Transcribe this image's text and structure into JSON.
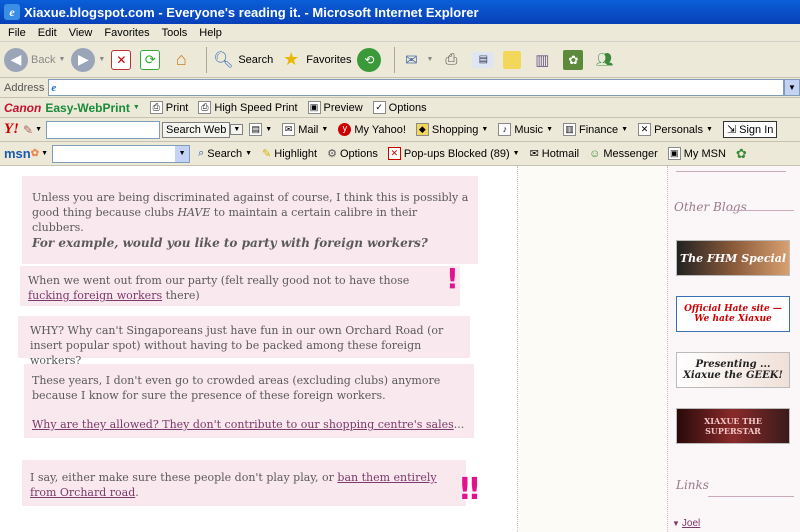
{
  "window": {
    "title": "Xiaxue.blogspot.com - Everyone's reading it. - Microsoft Internet Explorer"
  },
  "menu": [
    "File",
    "Edit",
    "View",
    "Favorites",
    "Tools",
    "Help"
  ],
  "toolbar": {
    "back": "Back",
    "search": "Search",
    "favorites": "Favorites"
  },
  "address": {
    "label": "Address",
    "value": ""
  },
  "canon_bar": {
    "brand": "Canon",
    "product": "Easy-WebPrint",
    "print": "Print",
    "high_speed_print": "High Speed Print",
    "preview": "Preview",
    "options": "Options"
  },
  "yahoo_bar": {
    "logo": "Y!",
    "search_button": "Search Web",
    "mail": "Mail",
    "my_yahoo": "My Yahoo!",
    "shopping": "Shopping",
    "music": "Music",
    "finance": "Finance",
    "personals": "Personals",
    "sign_in": "Sign In"
  },
  "msn_bar": {
    "logo": "msn",
    "search": "Search",
    "highlight": "Highlight",
    "options": "Options",
    "popups": "Pop-ups Blocked (89)",
    "hotmail": "Hotmail",
    "messenger": "Messenger",
    "my_msn": "My MSN"
  },
  "post": {
    "p1": "Unless you are being discriminated against of course, I think this is possibly a good thing because clubs ",
    "p1_em": "HAVE",
    "p1_end": " to maintain a certain calibre in their clubbers.",
    "question": "For example, would you like to party with foreign workers?",
    "p2_start": "When we went out from our party (felt really good not to have those ",
    "p2_link": "fucking foreign workers",
    "p2_end": " there)",
    "p3": "WHY? Why can't Singaporeans just have fun in our own Orchard Road (or insert popular spot) without having to be packed among these foreign workers?",
    "p4": "These years, I don't even go to crowded areas (excluding clubs) anymore because I know for sure the presence of these foreign workers.",
    "p5_link": "Why are they allowed? They don't contribute to our shopping centre's sales",
    "p5_end": "...",
    "p6_start": "I say, either make sure these people don't play play, or ",
    "p6_link": "ban them entirely from Orchard road",
    "p6_end": "."
  },
  "sidebar": {
    "other_blogs": "Other Blogs",
    "links": "Links",
    "banners": [
      "The FHM Special",
      "Official Hate site — We hate Xiaxue",
      "Presenting ... Xiaxue the GEEK!",
      "XIAXUE THE SUPERSTAR"
    ],
    "first_link": "Joel"
  }
}
